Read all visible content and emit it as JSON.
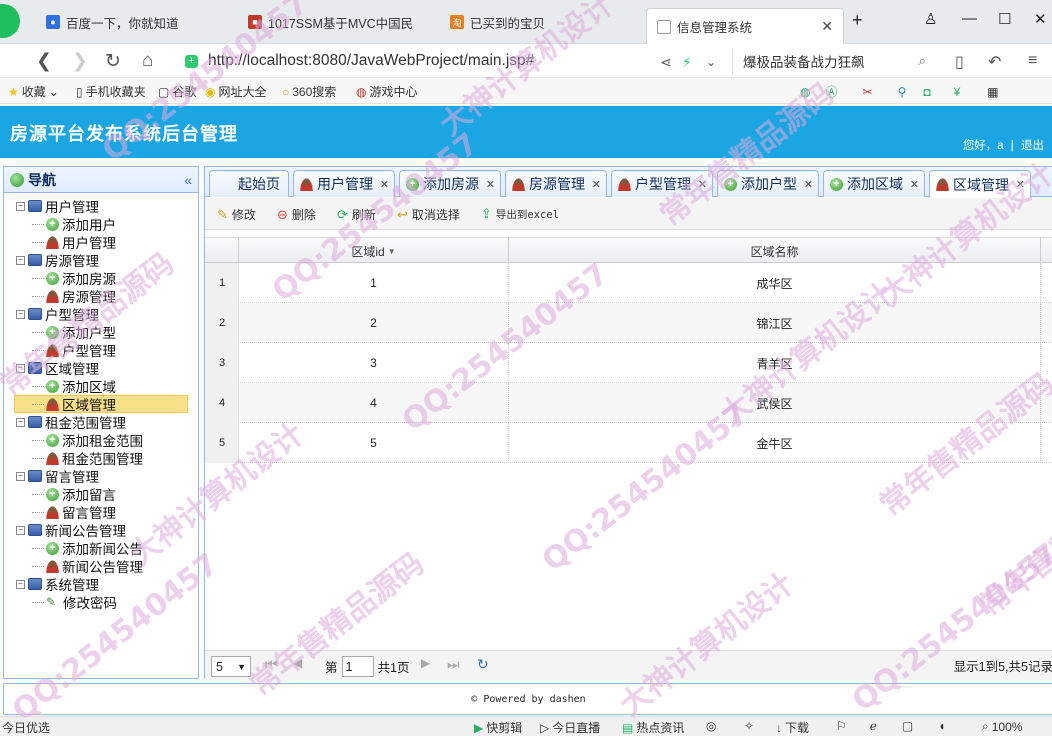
{
  "browser": {
    "tabs": [
      {
        "label": "百度一下，你就知道",
        "icon": "baidu-paw-icon",
        "color": "#2f6fe0"
      },
      {
        "label": "1017SSM基于MVC中国民",
        "icon": "site-favicon",
        "color": "#c0392b"
      },
      {
        "label": "已买到的宝贝",
        "icon": "taobao-icon",
        "color": "#e67e22"
      },
      {
        "label": "信息管理系统",
        "icon": "page-icon",
        "color": "#999999"
      }
    ],
    "url": "http://localhost:8080/JavaWebProject/main.jsp#",
    "url_host": "localhost",
    "search_text": "爆极品装备战力狂飙",
    "bookmarks": [
      "收藏",
      "手机收藏夹",
      "谷歌",
      "网址大全",
      "360搜索",
      "游戏中心"
    ],
    "zoom": "100%"
  },
  "app": {
    "title": "房源平台发布系统后台管理",
    "greeting": "您好，a",
    "logout": "退出",
    "accent": "#1ba6e3"
  },
  "nav": {
    "title": "导航",
    "groups": [
      {
        "label": "用户管理",
        "children": [
          {
            "label": "添加用户",
            "icon": "add-icon"
          },
          {
            "label": "用户管理",
            "icon": "user-icon"
          }
        ]
      },
      {
        "label": "房源管理",
        "children": [
          {
            "label": "添加房源",
            "icon": "add-icon"
          },
          {
            "label": "房源管理",
            "icon": "user-icon"
          }
        ]
      },
      {
        "label": "户型管理",
        "children": [
          {
            "label": "添加户型",
            "icon": "add-icon"
          },
          {
            "label": "户型管理",
            "icon": "user-icon"
          }
        ]
      },
      {
        "label": "区域管理",
        "children": [
          {
            "label": "添加区域",
            "icon": "add-icon"
          },
          {
            "label": "区域管理",
            "icon": "user-icon",
            "selected": true
          }
        ]
      },
      {
        "label": "租金范围管理",
        "children": [
          {
            "label": "添加租金范围",
            "icon": "add-icon"
          },
          {
            "label": "租金范围管理",
            "icon": "user-icon"
          }
        ]
      },
      {
        "label": "留言管理",
        "children": [
          {
            "label": "添加留言",
            "icon": "add-icon"
          },
          {
            "label": "留言管理",
            "icon": "user-icon"
          }
        ]
      },
      {
        "label": "新闻公告管理",
        "children": [
          {
            "label": "添加新闻公告",
            "icon": "add-icon"
          },
          {
            "label": "新闻公告管理",
            "icon": "user-icon"
          }
        ]
      },
      {
        "label": "系统管理",
        "children": [
          {
            "label": "修改密码",
            "icon": "pencil-icon"
          }
        ]
      }
    ]
  },
  "tabs": [
    {
      "label": "起始页",
      "closable": false
    },
    {
      "label": "用户管理",
      "closable": true,
      "icon": "user-icon"
    },
    {
      "label": "添加房源",
      "closable": true,
      "icon": "add-icon"
    },
    {
      "label": "房源管理",
      "closable": true,
      "icon": "user-icon"
    },
    {
      "label": "户型管理",
      "closable": true,
      "icon": "user-icon"
    },
    {
      "label": "添加户型",
      "closable": true,
      "icon": "add-icon"
    },
    {
      "label": "添加区域",
      "closable": true,
      "icon": "add-icon"
    },
    {
      "label": "区域管理",
      "closable": true,
      "icon": "user-icon",
      "active": true
    }
  ],
  "toolbar": {
    "edit": "修改",
    "delete": "删除",
    "refresh": "刷新",
    "cancel_select": "取消选择",
    "export": "导出到excel"
  },
  "grid": {
    "columns": [
      "区域id",
      "区域名称"
    ],
    "rows": [
      {
        "no": "1",
        "id": "1",
        "name": "成华区"
      },
      {
        "no": "2",
        "id": "2",
        "name": "锦江区"
      },
      {
        "no": "3",
        "id": "3",
        "name": "青羊区"
      },
      {
        "no": "4",
        "id": "4",
        "name": "武侯区"
      },
      {
        "no": "5",
        "id": "5",
        "name": "金牛区"
      }
    ]
  },
  "pager": {
    "page_size": "5",
    "page_prefix": "第",
    "page": "1",
    "page_suffix": "共1页",
    "summary": "显示1到5,共5记录"
  },
  "footer": "Powered by dashen",
  "statusbar": {
    "left": "今日优选",
    "items": [
      "快剪辑",
      "今日直播",
      "热点资讯",
      "下载"
    ]
  },
  "watermarks": [
    "QQ:254540457",
    "大神计算机设计",
    "常年售精品源码"
  ]
}
